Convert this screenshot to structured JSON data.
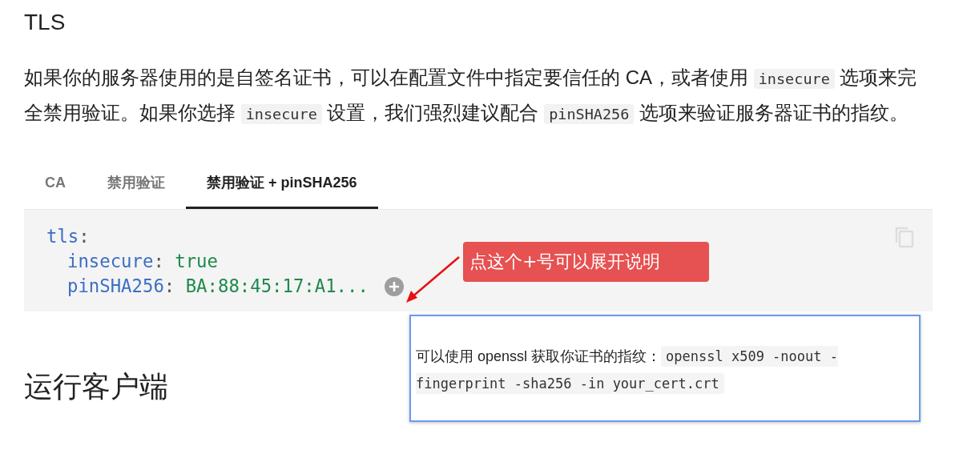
{
  "section_title": "TLS",
  "intro": [
    {
      "kind": "text",
      "text": "如果你的服务器使用的是自签名证书，可以在配置文件中指定要信任的 CA，或者使用 "
    },
    {
      "kind": "code",
      "text": "insecure"
    },
    {
      "kind": "text",
      "text": " 选项来完全禁用验证。如果你选择 "
    },
    {
      "kind": "code",
      "text": "insecure"
    },
    {
      "kind": "text",
      "text": " 设置，我们强烈建议配合 "
    },
    {
      "kind": "code",
      "text": "pinSHA256"
    },
    {
      "kind": "text",
      "text": " 选项来验证服务器证书的指纹。"
    }
  ],
  "tabs": [
    {
      "label": "CA",
      "selected": false
    },
    {
      "label": "禁用验证",
      "selected": false
    },
    {
      "label": "禁用验证 + pinSHA256",
      "selected": true
    }
  ],
  "code": [
    {
      "key": "tls",
      "punct": ":",
      "children": [
        {
          "key": "insecure",
          "punct": ":",
          "value": "true"
        },
        {
          "key": "pinSHA256",
          "punct": ":",
          "value": "BA:88:45:17:A1...",
          "annotated": true
        }
      ]
    }
  ],
  "annotation": {
    "text": "点这个+号可以展开说明"
  },
  "popup": [
    {
      "kind": "text",
      "text": "可以使用 openssl 获取你证书的指纹："
    },
    {
      "kind": "code",
      "text": "openssl x509 -noout -fingerprint -sha256 -in your_cert.crt"
    }
  ],
  "next_heading": "运行客户端"
}
